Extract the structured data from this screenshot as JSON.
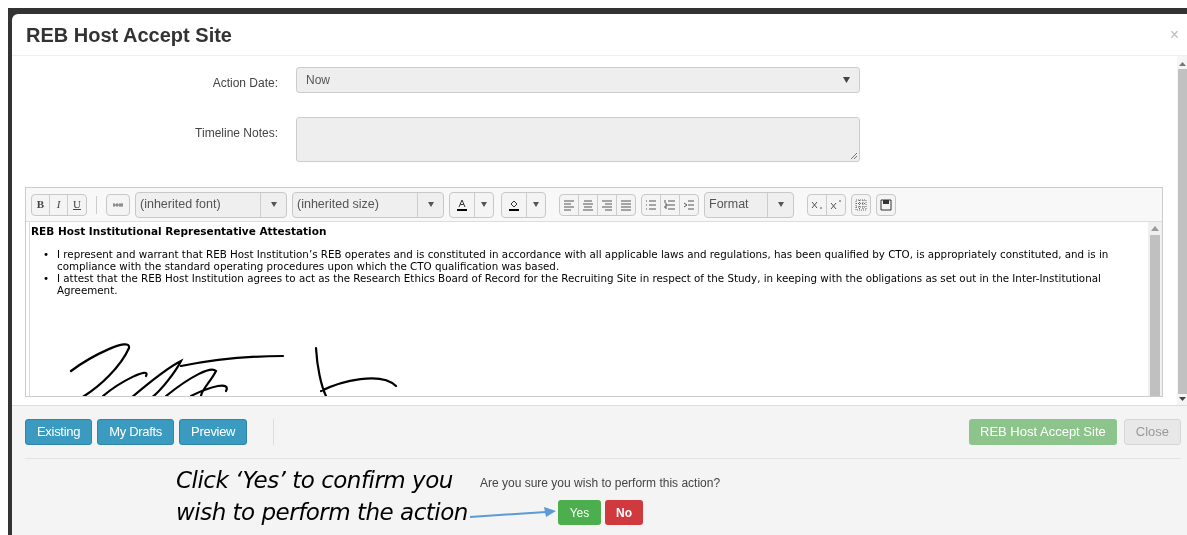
{
  "dialog": {
    "title": "REB Host Accept Site",
    "close": "×"
  },
  "form": {
    "fields": [
      {
        "kind": "select",
        "label": "Action Date:",
        "value": "Now"
      },
      {
        "kind": "textarea",
        "label": "Timeline Notes:"
      }
    ]
  },
  "editor": {
    "toolbar": {
      "bold": "B",
      "italic": "I",
      "underline": "U",
      "font": "(inherited font)",
      "size": "(inherited size)",
      "format": "Format"
    },
    "heading": "REB Host Institutional Representative Attestation",
    "bullet_marker": "•",
    "bullets": [
      "I represent and warrant that REB Host Institution’s REB operates and is constituted in accordance with all applicable laws and regulations, has been qualified by CTO, is appropriately constituted, and is in compliance with the standard operating procedures upon which the CTO qualification was based.",
      "I attest that the REB Host Institution agrees to act as the Research Ethics Board of Record for the Recruiting Site in respect of the Study, in keeping with the obligations as set out in the Inter-Institutional Agreement."
    ]
  },
  "footer": {
    "left_buttons": [
      "Existing",
      "My Drafts",
      "Preview"
    ],
    "submit": {
      "label": "REB Host Accept Site",
      "disabled": true
    },
    "close": "Close"
  },
  "confirm": {
    "question": "Are you sure you wish to perform this action?",
    "yes": "Yes",
    "no": "No"
  },
  "annotation": {
    "lines": [
      "Click ‘Yes’ to confirm you",
      "wish to perform the action"
    ]
  }
}
